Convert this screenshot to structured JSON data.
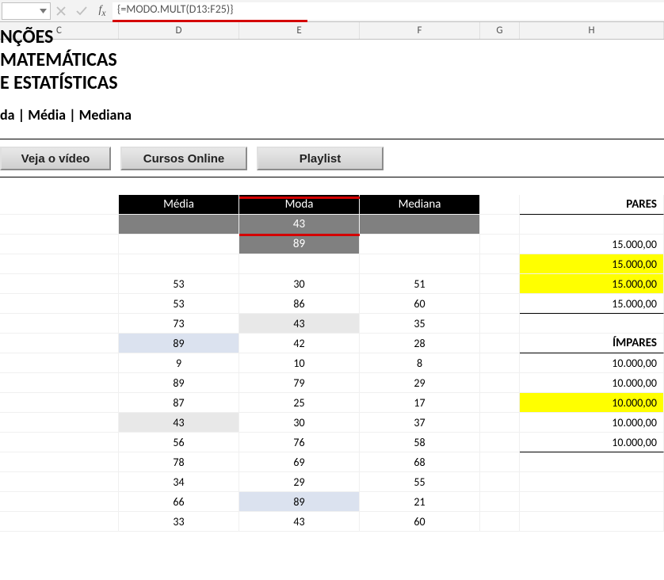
{
  "formula_bar": {
    "value": "{=MODO.MULT(D13:F25)}"
  },
  "columns": {
    "C": "C",
    "D": "D",
    "E": "E",
    "F": "F",
    "G": "G",
    "H": "H"
  },
  "title": "NÇÕES MATEMÁTICAS E ESTATÍSTICAS",
  "subtitle": "da | Média | Mediana",
  "buttons": {
    "b1": "Veja o vídeo",
    "b2": "Cursos Online",
    "b3": "Playlist"
  },
  "stat_headers": {
    "d": "Média",
    "e": "Moda",
    "f": "Mediana"
  },
  "stat_row1": {
    "e": "43"
  },
  "stat_row2": {
    "e": "89"
  },
  "data": [
    {
      "d": "53",
      "e": "30",
      "f": "51"
    },
    {
      "d": "53",
      "e": "86",
      "f": "60"
    },
    {
      "d": "73",
      "e": "43",
      "f": "35",
      "e_hl": "g"
    },
    {
      "d": "89",
      "e": "42",
      "f": "28",
      "d_hl": "b"
    },
    {
      "d": "9",
      "e": "10",
      "f": "8"
    },
    {
      "d": "89",
      "e": "79",
      "f": "29"
    },
    {
      "d": "87",
      "e": "25",
      "f": "17"
    },
    {
      "d": "43",
      "e": "30",
      "f": "37",
      "d_hl": "g"
    },
    {
      "d": "56",
      "e": "76",
      "f": "58"
    },
    {
      "d": "78",
      "e": "69",
      "f": "68"
    },
    {
      "d": "34",
      "e": "29",
      "f": "55"
    },
    {
      "d": "66",
      "e": "89",
      "f": "21",
      "e_hl": "b"
    },
    {
      "d": "33",
      "e": "43",
      "f": "60"
    }
  ],
  "pares": {
    "label": "PARES",
    "rows": [
      {
        "v": "15.000,00",
        "y": false
      },
      {
        "v": "15.000,00",
        "y": true
      },
      {
        "v": "15.000,00",
        "y": true
      },
      {
        "v": "15.000,00",
        "y": false
      }
    ]
  },
  "impares": {
    "label": "ÍMPARES",
    "rows": [
      {
        "v": "10.000,00",
        "y": false
      },
      {
        "v": "10.000,00",
        "y": false
      },
      {
        "v": "10.000,00",
        "y": true
      },
      {
        "v": "10.000,00",
        "y": false
      },
      {
        "v": "10.000,00",
        "y": false
      }
    ]
  }
}
